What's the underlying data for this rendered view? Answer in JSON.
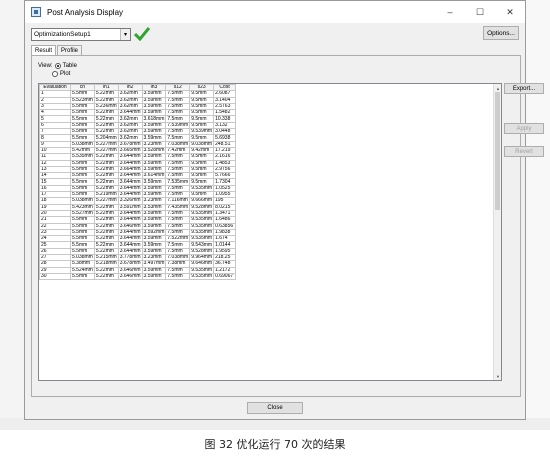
{
  "window": {
    "title": "Post Analysis Display",
    "minimize": "–",
    "maximize": "☐",
    "close": "✕"
  },
  "toolbar": {
    "setup_value": "OptimizationSetup1",
    "dropdown_arrow": "▾",
    "options_label": "Options..."
  },
  "tabs": [
    {
      "label": "Result"
    },
    {
      "label": "Profile"
    }
  ],
  "view": {
    "label": "View:",
    "option_table": "Table",
    "option_plot": "Plot",
    "selected": "Table"
  },
  "table": {
    "columns": [
      "Evaluation",
      "ch",
      "lh1",
      "lh2",
      "lh3",
      "s12",
      "s23",
      "Cost"
    ],
    "rows": [
      [
        "1",
        "5.5mm",
        "5.22mm",
        "3.62mm",
        "3.59mm",
        "7.5mm",
        "9.5mm",
        "2.6087"
      ],
      [
        "2",
        "5.523mm",
        "5.22mm",
        "3.62mm",
        "3.59mm",
        "7.5mm",
        "9.5mm",
        "3.1404"
      ],
      [
        "3",
        "5.5mm",
        "5.236mm",
        "3.62mm",
        "3.59mm",
        "7.5mm",
        "9.5mm",
        "2.5763"
      ],
      [
        "4",
        "5.5mm",
        "5.22mm",
        "3.644mm",
        "3.59mm",
        "7.5mm",
        "9.5mm",
        "1.5482"
      ],
      [
        "5",
        "5.5mm",
        "5.22mm",
        "3.62mm",
        "3.618mm",
        "7.5mm",
        "9.5mm",
        "10.338"
      ],
      [
        "6",
        "5.5mm",
        "5.22mm",
        "3.62mm",
        "3.59mm",
        "7.539mm",
        "9.5mm",
        "3.132"
      ],
      [
        "7",
        "5.5mm",
        "5.22mm",
        "3.62mm",
        "3.59mm",
        "7.5mm",
        "9.539mm",
        "3.0448"
      ],
      [
        "8",
        "5.5mm",
        "5.204mm",
        "3.62mm",
        "3.59mm",
        "7.5mm",
        "9.5mm",
        "5.6938"
      ],
      [
        "9",
        "5.038mm",
        "5.227mm",
        "3.678mm",
        "3.23mm",
        "7.038mm",
        "9.038mm",
        "248.51"
      ],
      [
        "10",
        "5.42mm",
        "5.227mm",
        "3.665mm",
        "3.528mm",
        "7.42mm",
        "9.42mm",
        "17.219"
      ],
      [
        "11",
        "5.535mm",
        "5.22mm",
        "3.644mm",
        "3.59mm",
        "7.5mm",
        "9.5mm",
        "2.1616"
      ],
      [
        "12",
        "5.5mm",
        "5.22mm",
        "3.644mm",
        "3.59mm",
        "7.5mm",
        "9.5mm",
        "1.4853"
      ],
      [
        "13",
        "5.5mm",
        "5.22mm",
        "3.664mm",
        "3.59mm",
        "7.5mm",
        "9.5mm",
        "2.9756"
      ],
      [
        "14",
        "5.5mm",
        "5.22mm",
        "3.644mm",
        "3.614mm",
        "7.5mm",
        "9.5mm",
        "5.7666"
      ],
      [
        "15",
        "5.5mm",
        "5.22mm",
        "3.644mm",
        "3.59mm",
        "7.535mm",
        "9.5mm",
        "1.7304"
      ],
      [
        "16",
        "5.5mm",
        "5.22mm",
        "3.644mm",
        "3.59mm",
        "7.5mm",
        "9.535mm",
        "1.0525"
      ],
      [
        "17",
        "5.5mm",
        "5.219mm",
        "3.644mm",
        "3.59mm",
        "7.5mm",
        "9.5mm",
        "1.0955"
      ],
      [
        "18",
        "5.038mm",
        "5.227mm",
        "3.326mm",
        "3.23mm",
        "7.116mm",
        "9.666mm",
        "195"
      ],
      [
        "19",
        "5.423mm",
        "5.22mm",
        "3.591mm",
        "3.53mm",
        "7.435mm",
        "9.528mm",
        "8.0215"
      ],
      [
        "20",
        "5.527mm",
        "5.22mm",
        "3.644mm",
        "3.59mm",
        "7.5mm",
        "9.535mm",
        "1.3471"
      ],
      [
        "21",
        "5.5mm",
        "5.22mm",
        "3.644mm",
        "3.59mm",
        "7.5mm",
        "9.535mm",
        "1.6486"
      ],
      [
        "22",
        "5.5mm",
        "5.22mm",
        "3.646mm",
        "3.59mm",
        "7.5mm",
        "9.535mm",
        "0.63856"
      ],
      [
        "23",
        "5.5mm",
        "5.22mm",
        "3.644mm",
        "3.592mm",
        "7.5mm",
        "9.535mm",
        "1.9838"
      ],
      [
        "24",
        "5.5mm",
        "5.22mm",
        "3.644mm",
        "3.59mm",
        "7.522mm",
        "9.535mm",
        "1.674"
      ],
      [
        "25",
        "5.5mm",
        "5.22mm",
        "3.644mm",
        "3.59mm",
        "7.5mm",
        "9.543mm",
        "1.0144"
      ],
      [
        "26",
        "5.5mm",
        "5.22mm",
        "3.644mm",
        "3.59mm",
        "7.5mm",
        "9.528mm",
        "1.9595"
      ],
      [
        "27",
        "5.038mm",
        "5.215mm",
        "3.778mm",
        "3.23mm",
        "7.038mm",
        "9.964mm",
        "218.25"
      ],
      [
        "28",
        "5.38mm",
        "5.218mm",
        "3.678mm",
        "3.497mm",
        "7.38mm",
        "9.646mm",
        "36.748"
      ],
      [
        "29",
        "5.524mm",
        "5.22mm",
        "3.646mm",
        "3.59mm",
        "7.5mm",
        "9.535mm",
        "1.2172"
      ],
      [
        "30",
        "5.5mm",
        "5.22mm",
        "3.646mm",
        "3.59mm",
        "7.5mm",
        "9.535mm",
        "0.69067"
      ]
    ]
  },
  "side_buttons": {
    "export": "Export...",
    "apply": "Apply",
    "revert": "Revert"
  },
  "footer": {
    "close_label": "Close"
  },
  "caption": "图 32 优化运行 70 次的结果"
}
